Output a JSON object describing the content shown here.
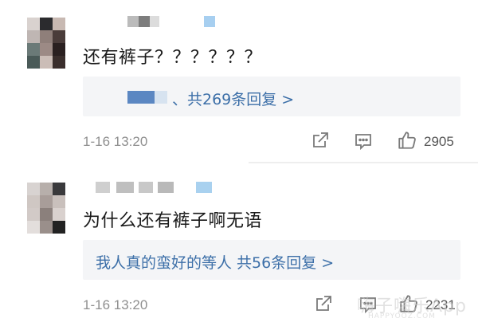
{
  "comments": [
    {
      "text": "还有裤子？？？？？？",
      "reply_summary": "、共269条回复 >",
      "time": "1-16 13:20",
      "like_count": "2905"
    },
    {
      "text": "为什么还有裤子啊无语",
      "reply_summary": "我人真的蛮好的等人  共56条回复 >",
      "time": "1-16 13:20",
      "like_count": "2231"
    }
  ],
  "icons": {
    "share": "share-icon",
    "comment": "comment-icon",
    "like": "thumbs-up-icon"
  },
  "watermark": {
    "main": "嗨子嗨乐App",
    "sub": "HAPPYOOZ.COM"
  },
  "colors": {
    "link": "#3c6fa8",
    "reply_bg": "#f4f5f7",
    "time": "#8f8f8f"
  }
}
